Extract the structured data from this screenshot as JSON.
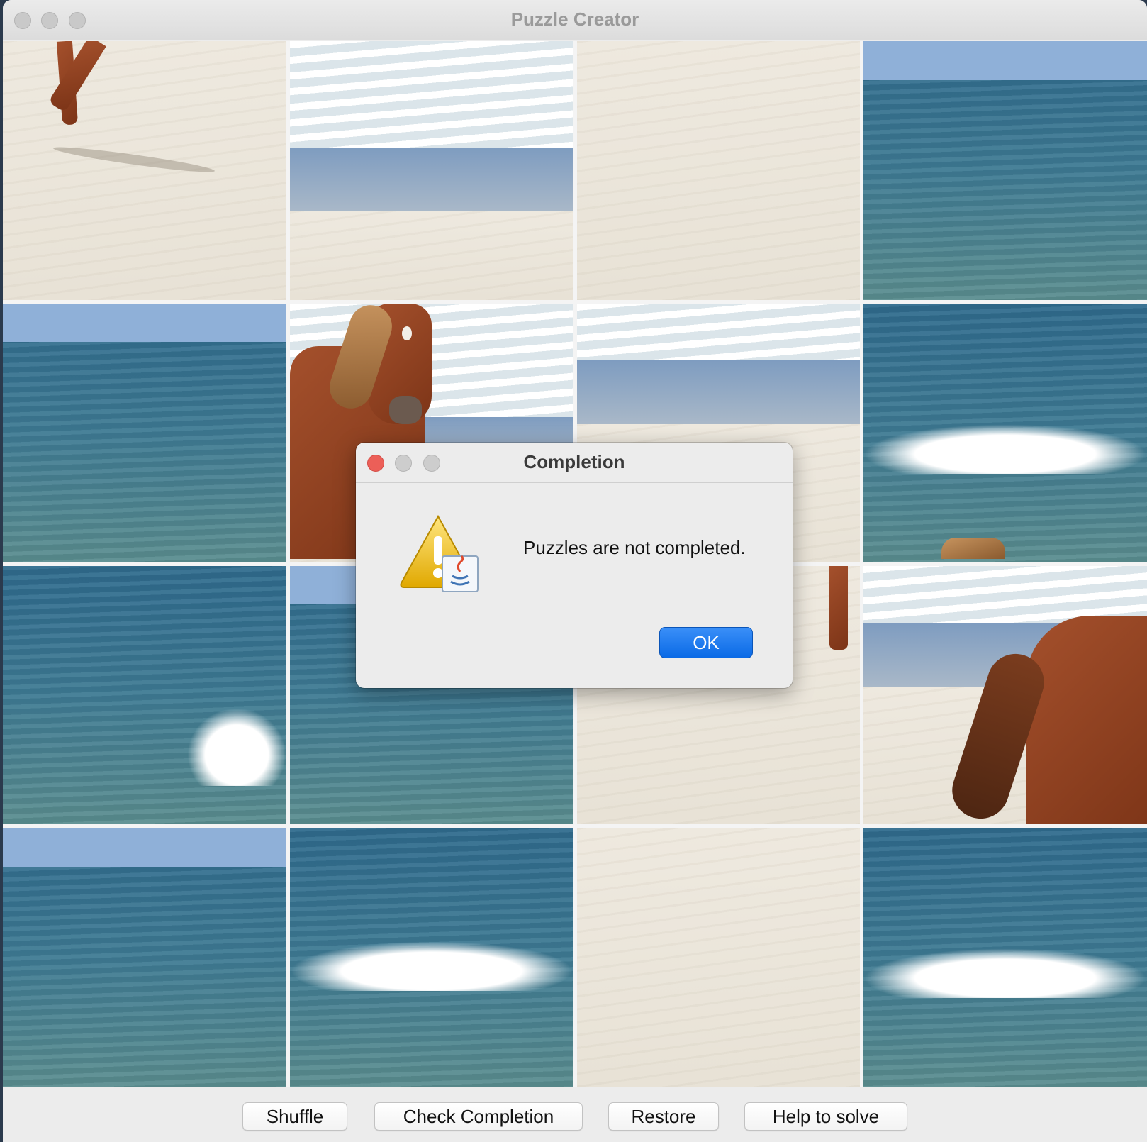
{
  "window": {
    "title": "Puzzle Creator"
  },
  "puzzle": {
    "tiles": [
      {
        "scene": "sand-hooves"
      },
      {
        "scene": "surf-shore"
      },
      {
        "scene": "sand"
      },
      {
        "scene": "ocean-sky"
      },
      {
        "scene": "ocean-sky"
      },
      {
        "scene": "horse-head-surf"
      },
      {
        "scene": "surf-shore"
      },
      {
        "scene": "ocean-wave"
      },
      {
        "scene": "ocean-wave"
      },
      {
        "scene": "ocean-sky"
      },
      {
        "scene": "sand-leg"
      },
      {
        "scene": "horse-body-surf"
      },
      {
        "scene": "ocean-sky"
      },
      {
        "scene": "ocean-wave"
      },
      {
        "scene": "sand"
      },
      {
        "scene": "ocean-wave"
      }
    ]
  },
  "toolbar": {
    "shuffle_label": "Shuffle",
    "check_label": "Check Completion",
    "restore_label": "Restore",
    "help_label": "Help to solve"
  },
  "dialog": {
    "title": "Completion",
    "message": "Puzzles are not completed.",
    "ok_label": "OK",
    "icon": "warning-java-icon"
  },
  "colors": {
    "close_red": "#ec5f58",
    "ok_blue": "#0a6ae6"
  }
}
